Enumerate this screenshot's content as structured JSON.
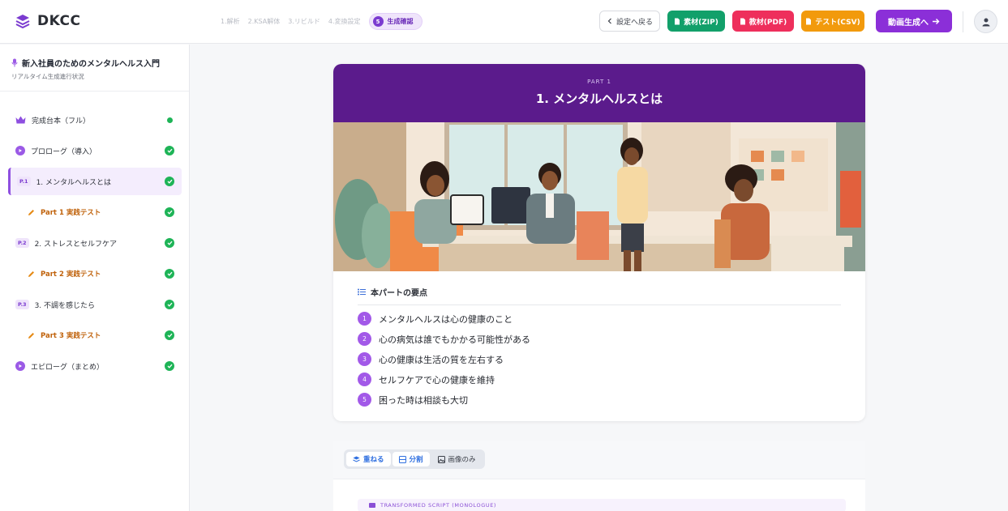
{
  "app": {
    "name": "DKCC"
  },
  "steps": [
    {
      "label": "1.解析"
    },
    {
      "label": "2.KSA解体"
    },
    {
      "label": "3.リビルド"
    },
    {
      "label": "4.変換設定"
    }
  ],
  "active_step": {
    "number": "5",
    "label": "生成確認"
  },
  "header_buttons": {
    "back": "設定へ戻る",
    "zip": "素材(ZIP)",
    "pdf": "教材(PDF)",
    "csv": "テスト(CSV)",
    "video": "動画生成へ"
  },
  "sidebar": {
    "title": "新入社員のためのメンタルヘルス入門",
    "subtitle": "リアルタイム生成進行状況",
    "items": [
      {
        "label": "完成台本（フル）",
        "icon": "crown-icon"
      },
      {
        "label": "プロローグ（導入）",
        "icon": "play-icon"
      },
      {
        "badge": "P.1",
        "label": "1. メンタルヘルスとは",
        "active": true
      },
      {
        "label": "Part 1 実践テスト",
        "icon": "pencil-icon"
      },
      {
        "badge": "P.2",
        "label": "2. ストレスとセルフケア"
      },
      {
        "label": "Part 2 実践テスト",
        "icon": "pencil-icon"
      },
      {
        "badge": "P.3",
        "label": "3. 不調を感じたら"
      },
      {
        "label": "Part 3 実践テスト",
        "icon": "pencil-icon"
      },
      {
        "label": "エピローグ（まとめ）",
        "icon": "play-icon"
      }
    ]
  },
  "card": {
    "part_label": "PART 1",
    "title": "1. メンタルヘルスとは",
    "points_heading": "本パートの要点",
    "points": [
      {
        "n": "1",
        "text": "メンタルヘルスは心の健康のこと"
      },
      {
        "n": "2",
        "text": "心の病気は誰でもかかる可能性がある"
      },
      {
        "n": "3",
        "text": "心の健康は生活の質を左右する"
      },
      {
        "n": "4",
        "text": "セルフケアで心の健康を維持"
      },
      {
        "n": "5",
        "text": "困った時は相談も大切"
      }
    ]
  },
  "view_modes": [
    "重ねる",
    "分割",
    "画像のみ"
  ],
  "script_label": "TRANSFORMED SCRIPT (MONOLOGUE)",
  "colors": {
    "accent": "#8b2fd8",
    "header_purple": "#5b1b8c",
    "success": "#1eb457"
  }
}
